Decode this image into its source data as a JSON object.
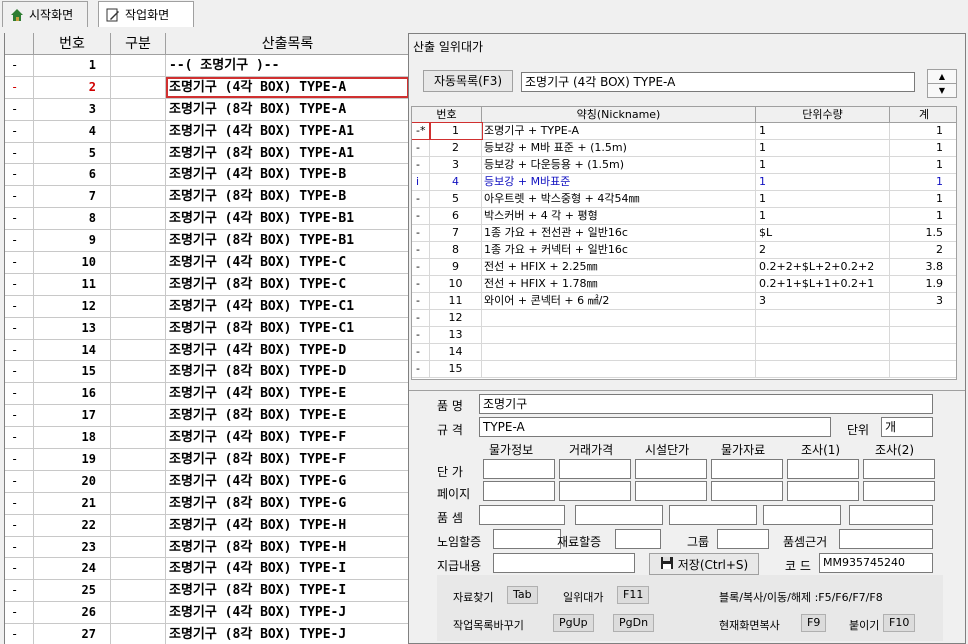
{
  "tabs": [
    {
      "label": "시작화면",
      "icon": "home-icon"
    },
    {
      "label": "작업화면",
      "icon": "note-edit-icon"
    }
  ],
  "left_grid": {
    "headers": {
      "num": "번호",
      "div": "구분",
      "name": "산출목록"
    },
    "rows": [
      {
        "mark": "-",
        "num": "1",
        "name": "--( 조명기구 )--"
      },
      {
        "mark": "-",
        "num": "2",
        "name": "조명기구 (4각 BOX) TYPE-A"
      },
      {
        "mark": "-",
        "num": "3",
        "name": "조명기구 (8각 BOX) TYPE-A"
      },
      {
        "mark": "-",
        "num": "4",
        "name": "조명기구 (4각 BOX) TYPE-A1"
      },
      {
        "mark": "-",
        "num": "5",
        "name": "조명기구 (8각 BOX) TYPE-A1"
      },
      {
        "mark": "-",
        "num": "6",
        "name": "조명기구 (4각 BOX) TYPE-B"
      },
      {
        "mark": "-",
        "num": "7",
        "name": "조명기구 (8각 BOX) TYPE-B"
      },
      {
        "mark": "-",
        "num": "8",
        "name": "조명기구 (4각 BOX) TYPE-B1"
      },
      {
        "mark": "-",
        "num": "9",
        "name": "조명기구 (8각 BOX) TYPE-B1"
      },
      {
        "mark": "-",
        "num": "10",
        "name": "조명기구 (4각 BOX) TYPE-C"
      },
      {
        "mark": "-",
        "num": "11",
        "name": "조명기구 (8각 BOX) TYPE-C"
      },
      {
        "mark": "-",
        "num": "12",
        "name": "조명기구 (4각 BOX) TYPE-C1"
      },
      {
        "mark": "-",
        "num": "13",
        "name": "조명기구 (8각 BOX) TYPE-C1"
      },
      {
        "mark": "-",
        "num": "14",
        "name": "조명기구 (4각 BOX) TYPE-D"
      },
      {
        "mark": "-",
        "num": "15",
        "name": "조명기구 (8각 BOX) TYPE-D"
      },
      {
        "mark": "-",
        "num": "16",
        "name": "조명기구 (4각 BOX) TYPE-E"
      },
      {
        "mark": "-",
        "num": "17",
        "name": "조명기구 (8각 BOX) TYPE-E"
      },
      {
        "mark": "-",
        "num": "18",
        "name": "조명기구 (4각 BOX) TYPE-F"
      },
      {
        "mark": "-",
        "num": "19",
        "name": "조명기구 (8각 BOX) TYPE-F"
      },
      {
        "mark": "-",
        "num": "20",
        "name": "조명기구 (4각 BOX) TYPE-G"
      },
      {
        "mark": "-",
        "num": "21",
        "name": "조명기구 (8각 BOX) TYPE-G"
      },
      {
        "mark": "-",
        "num": "22",
        "name": "조명기구 (4각 BOX) TYPE-H"
      },
      {
        "mark": "-",
        "num": "23",
        "name": "조명기구 (8각 BOX) TYPE-H"
      },
      {
        "mark": "-",
        "num": "24",
        "name": "조명기구 (4각 BOX) TYPE-I"
      },
      {
        "mark": "-",
        "num": "25",
        "name": "조명기구 (8각 BOX) TYPE-I"
      },
      {
        "mark": "-",
        "num": "26",
        "name": "조명기구 (4각 BOX) TYPE-J"
      },
      {
        "mark": "-",
        "num": "27",
        "name": "조명기구 (8각 BOX) TYPE-J"
      }
    ],
    "selected_index": 1
  },
  "panel": {
    "title": "산출 일위대가",
    "auto_button": "자동목록(F3)",
    "auto_value": "조명기구 (4각 BOX) TYPE-A",
    "grid_headers": {
      "num": "번호",
      "nick": "약칭(Nickname)",
      "qty": "단위수량",
      "total": "계"
    },
    "grid_rows": [
      {
        "mark": "-*",
        "num": "1",
        "nick": "조명기구 + TYPE-A",
        "qty": "1",
        "total": "1"
      },
      {
        "mark": "-",
        "num": "2",
        "nick": "등보강 + M바 표준 + (1.5m)",
        "qty": "1",
        "total": "1"
      },
      {
        "mark": "-",
        "num": "3",
        "nick": "등보강 + 다운등용 + (1.5m)",
        "qty": "1",
        "total": "1"
      },
      {
        "mark": "i",
        "num": "4",
        "nick": "등보강 + M바표준",
        "qty": "1",
        "total": "1"
      },
      {
        "mark": "-",
        "num": "5",
        "nick": "아우트렛 + 박스중형 + 4각54㎜",
        "qty": "1",
        "total": "1"
      },
      {
        "mark": "-",
        "num": "6",
        "nick": "박스커버 + 4 각 + 평형",
        "qty": "1",
        "total": "1"
      },
      {
        "mark": "-",
        "num": "7",
        "nick": "1종 가요 + 전선관 + 일반16c",
        "qty": "$L",
        "total": "1.5"
      },
      {
        "mark": "-",
        "num": "8",
        "nick": "1종 가요 + 커넥터 + 일반16c",
        "qty": "2",
        "total": "2"
      },
      {
        "mark": "-",
        "num": "9",
        "nick": "전선 + HFIX + 2.25㎜",
        "qty": "0.2+2+$L+2+0.2+2",
        "total": "3.8"
      },
      {
        "mark": "-",
        "num": "10",
        "nick": "전선 + HFIX + 1.78㎜",
        "qty": "0.2+1+$L+1+0.2+1",
        "total": "1.9"
      },
      {
        "mark": "-",
        "num": "11",
        "nick": "와이어 + 콘넥터 + 6 ㎟/2",
        "qty": "3",
        "total": "3"
      },
      {
        "mark": "-",
        "num": "12",
        "nick": "",
        "qty": "",
        "total": ""
      },
      {
        "mark": "-",
        "num": "13",
        "nick": "",
        "qty": "",
        "total": ""
      },
      {
        "mark": "-",
        "num": "14",
        "nick": "",
        "qty": "",
        "total": ""
      },
      {
        "mark": "-",
        "num": "15",
        "nick": "",
        "qty": "",
        "total": ""
      }
    ],
    "form": {
      "product_label": "품 명",
      "product_value": "조명기구",
      "spec_label": "규 격",
      "spec_value": "TYPE-A",
      "unit_label": "단위",
      "unit_value": "개",
      "col_headers": [
        "물가정보",
        "거래가격",
        "시설단가",
        "물가자료",
        "조사(1)",
        "조사(2)"
      ],
      "price_label": "단 가",
      "page_label": "페이지",
      "pumsem_label": "품 셈",
      "labor_label": "노임할증",
      "material_label": "재료할증",
      "group_label": "그룹",
      "pumsem_basis_label": "품셈근거",
      "payment_label": "지급내용",
      "save_button": "저장(Ctrl+S)",
      "code_label": "코 드",
      "code_value": "MM935745240"
    },
    "footer": {
      "find_label": "자료찾기",
      "find_key": "Tab",
      "unit_cost_label": "일위대가",
      "unit_cost_key": "F11",
      "block_label": "블록/복사/이동/해제 :F5/F6/F7/F8",
      "switch_label": "작업목록바꾸기",
      "switch_key1": "PgUp",
      "switch_key2": "PgDn",
      "copy_screen_label": "현재화면복사",
      "copy_screen_key": "F9",
      "paste_label": "붙이기",
      "paste_key": "F10"
    }
  }
}
